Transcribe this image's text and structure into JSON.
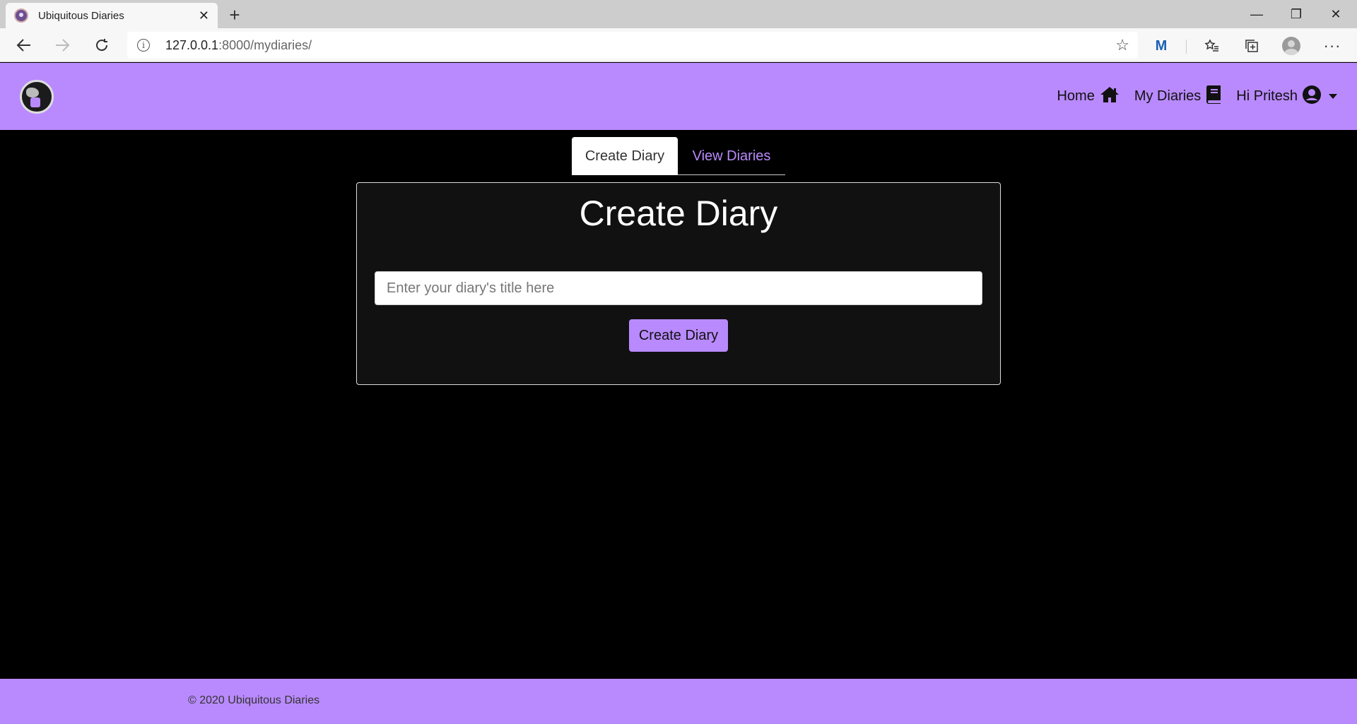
{
  "browser": {
    "tab_title": "Ubiquitous Diaries",
    "tab_close": "✕",
    "new_tab": "+",
    "url_host": "127.0.0.1",
    "url_path": ":8000/mydiaries/",
    "min": "—",
    "max": "❐",
    "close": "✕"
  },
  "header": {
    "nav": {
      "home": "Home",
      "my_diaries": "My Diaries",
      "user": "Hi Pritesh"
    }
  },
  "tabs": {
    "create": "Create Diary",
    "view": "View Diaries"
  },
  "card": {
    "heading": "Create Diary",
    "input_placeholder": "Enter your diary's title here",
    "button": "Create Diary"
  },
  "footer": {
    "text": "© 2020 Ubiquitous Diaries"
  },
  "colors": {
    "accent": "#b98afd",
    "page_bg": "#000000",
    "card_bg": "#111111"
  }
}
